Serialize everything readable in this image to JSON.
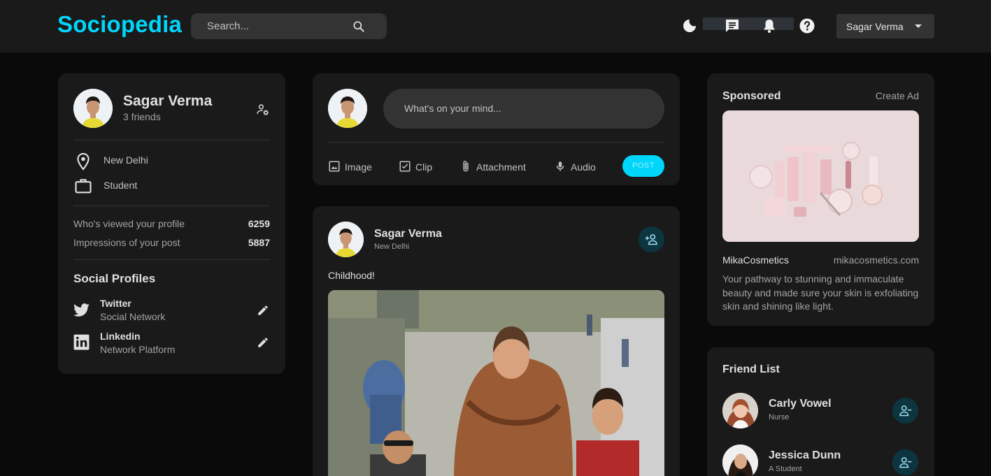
{
  "nav": {
    "logo": "Sociopedia",
    "search_placeholder": "Search...",
    "user_name": "Sagar Verma"
  },
  "profile": {
    "name": "Sagar Verma",
    "friends": "3 friends",
    "location": "New Delhi",
    "occupation": "Student",
    "stats": [
      {
        "label": "Who's viewed your profile",
        "value": "6259"
      },
      {
        "label": "Impressions of your post",
        "value": "5887"
      }
    ],
    "social_title": "Social Profiles",
    "socials": [
      {
        "name": "Twitter",
        "sub": "Social Network"
      },
      {
        "name": "Linkedin",
        "sub": "Network Platform"
      }
    ]
  },
  "composer": {
    "placeholder": "What's on your mind...",
    "actions": [
      "Image",
      "Clip",
      "Attachment",
      "Audio"
    ],
    "post_label": "POST"
  },
  "post": {
    "author": "Sagar Verma",
    "location": "New Delhi",
    "text": "Childhood!"
  },
  "sponsored": {
    "title": "Sponsored",
    "create_ad": "Create Ad",
    "brand": "MikaCosmetics",
    "url": "mikacosmetics.com",
    "description": "Your pathway to stunning and immaculate beauty and made sure your skin is exfoliating skin and shining like light."
  },
  "friends": {
    "title": "Friend List",
    "items": [
      {
        "name": "Carly Vowel",
        "sub": "Nurse"
      },
      {
        "name": "Jessica Dunn",
        "sub": "A Student"
      }
    ]
  },
  "colors": {
    "accent": "#00d5fa",
    "background": "#0a0a0a",
    "card": "#1a1a1a",
    "input": "#333333"
  }
}
